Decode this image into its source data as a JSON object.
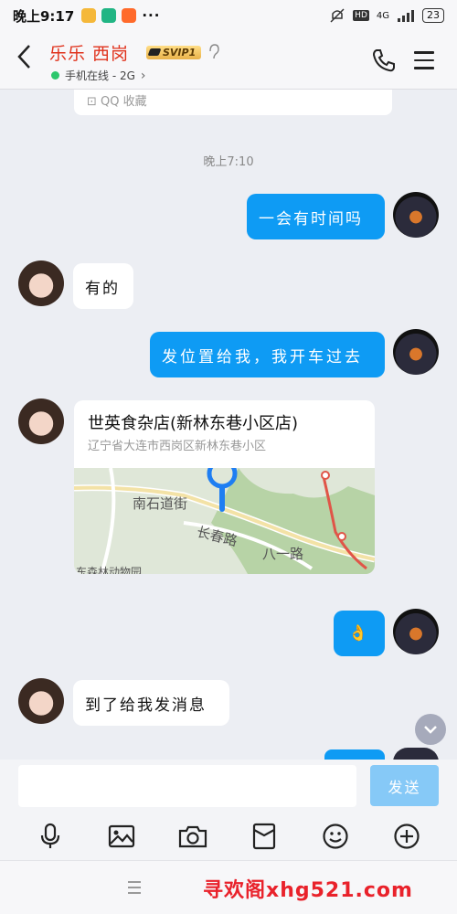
{
  "status_bar": {
    "time": "晚上9:17",
    "dots": "···",
    "network": "4G",
    "battery": "23"
  },
  "header": {
    "contact_name": "乐乐 西岗",
    "vip_badge": "SVIP1",
    "online_status": "手机在线 - 2G",
    "chevron": "›"
  },
  "chat": {
    "fav_card": "QQ 收藏",
    "timestamp": "晚上7:10",
    "messages": [
      {
        "side": "out",
        "text": "一会有时间吗"
      },
      {
        "side": "in",
        "text": "有的"
      },
      {
        "side": "out",
        "text": "发位置给我，我开车过去"
      },
      {
        "side": "in",
        "type": "location",
        "place_name": "世英食杂店(新林东巷小区店)",
        "address": "辽宁省大连市西岗区新林东巷小区"
      },
      {
        "side": "out",
        "text": "👌"
      },
      {
        "side": "in",
        "text": "到了给我发消息"
      }
    ],
    "map_labels": {
      "street1": "南石道街",
      "street2": "长春路",
      "street3": "八一路",
      "bottom": "东森林动物园"
    }
  },
  "input_bar": {
    "placeholder": "",
    "send_label": "发送"
  },
  "toolbar": {
    "items": [
      "microphone-icon",
      "image-icon",
      "camera-icon",
      "red-packet-icon",
      "emoji-icon",
      "plus-icon"
    ]
  },
  "watermark": "寻欢阁xhg521.com",
  "colors": {
    "out_bubble": "#0e9bf4",
    "send_disabled": "#86c9f7",
    "name_red": "#e0321c",
    "online_green": "#2dc76d"
  }
}
